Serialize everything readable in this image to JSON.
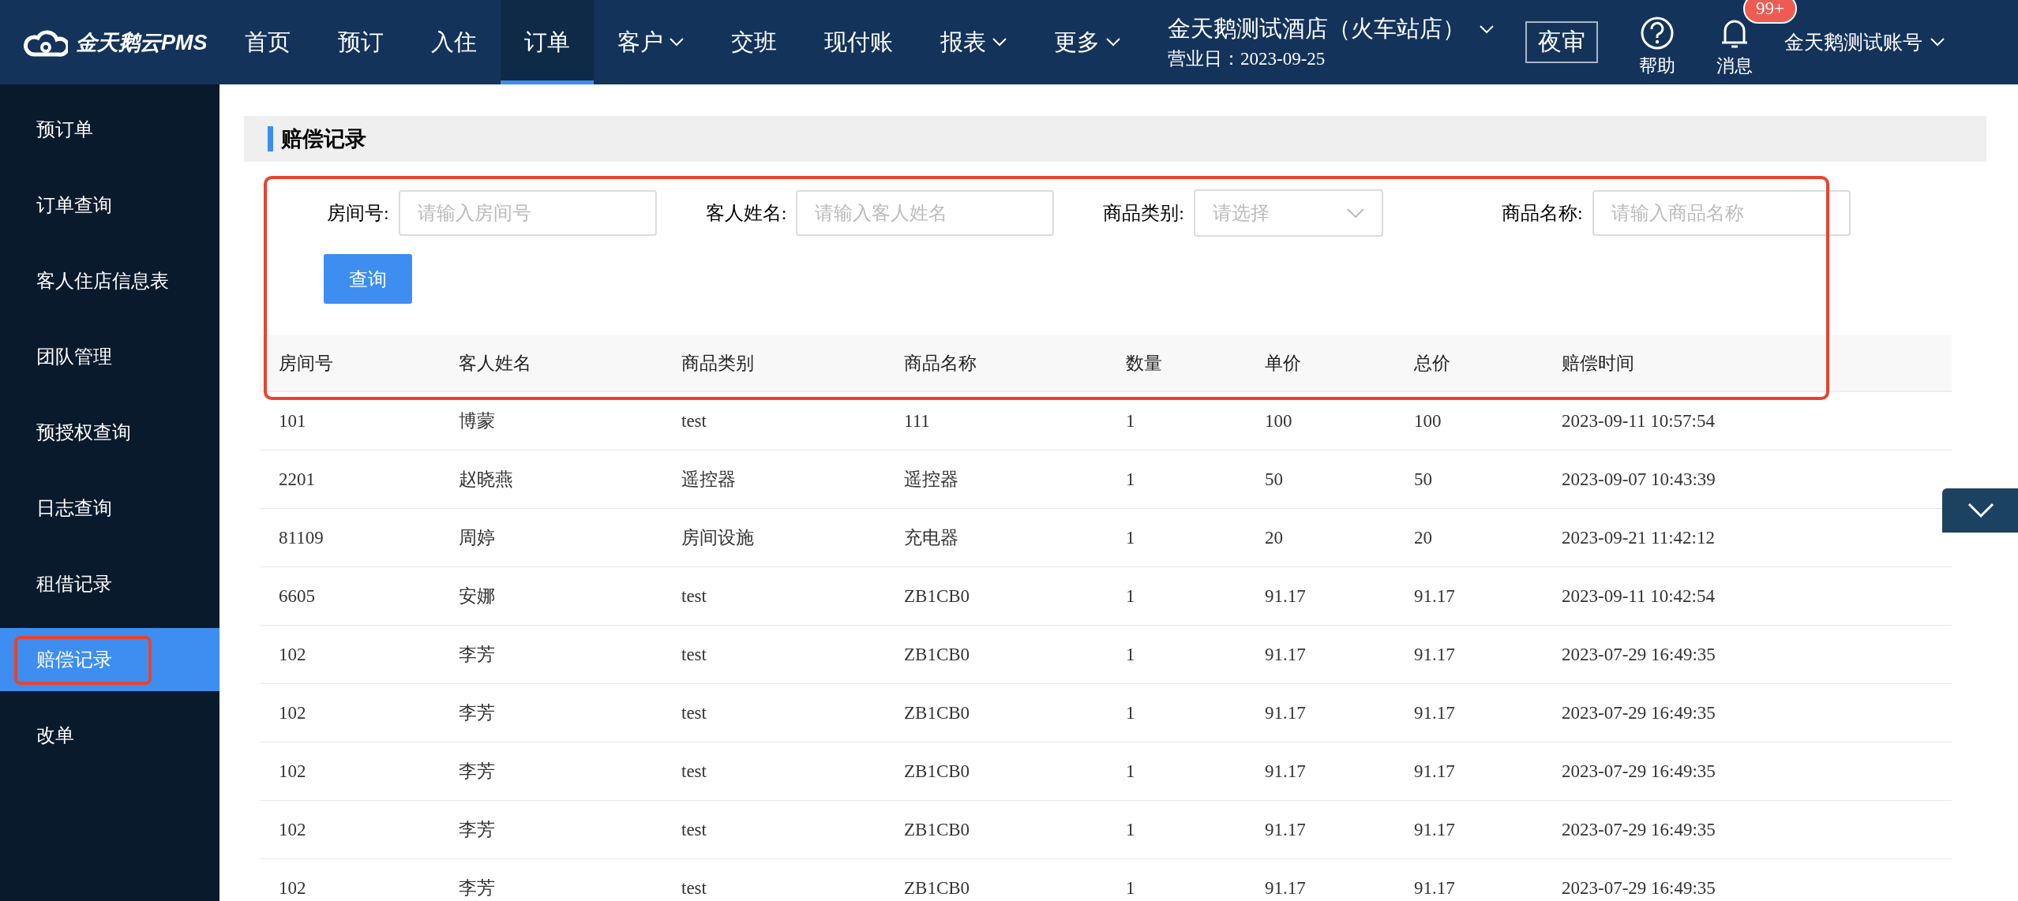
{
  "header": {
    "logo": "金天鹅云PMS",
    "nav": [
      {
        "label": "首页",
        "selected": false,
        "dropdown": false
      },
      {
        "label": "预订",
        "selected": false,
        "dropdown": false
      },
      {
        "label": "入住",
        "selected": false,
        "dropdown": false
      },
      {
        "label": "订单",
        "selected": true,
        "dropdown": false
      },
      {
        "label": "客户",
        "selected": false,
        "dropdown": true
      },
      {
        "label": "交班",
        "selected": false,
        "dropdown": false
      },
      {
        "label": "现付账",
        "selected": false,
        "dropdown": false
      },
      {
        "label": "报表",
        "selected": false,
        "dropdown": true
      },
      {
        "label": "更多",
        "selected": false,
        "dropdown": true
      }
    ],
    "hotel": "金天鹅测试酒店（火车站店）",
    "business_date": "营业日：2023-09-25",
    "night_audit": "夜审",
    "help": "帮助",
    "messages": "消息",
    "message_badge": "99+",
    "account": "金天鹅测试账号"
  },
  "sidebar": {
    "items": [
      {
        "label": "预订单",
        "selected": false,
        "highlighted": false
      },
      {
        "label": "订单查询",
        "selected": false,
        "highlighted": false
      },
      {
        "label": "客人住店信息表",
        "selected": false,
        "highlighted": false
      },
      {
        "label": "团队管理",
        "selected": false,
        "highlighted": false
      },
      {
        "label": "预授权查询",
        "selected": false,
        "highlighted": false
      },
      {
        "label": "日志查询",
        "selected": false,
        "highlighted": false
      },
      {
        "label": "租借记录",
        "selected": false,
        "highlighted": false
      },
      {
        "label": "赔偿记录",
        "selected": true,
        "highlighted": true
      },
      {
        "label": "改单",
        "selected": false,
        "highlighted": false
      }
    ]
  },
  "page_title": "赔偿记录",
  "filters": {
    "highlighted": true,
    "fields": [
      {
        "kind": "input",
        "label": "房间号:",
        "placeholder": "请输入房间号"
      },
      {
        "kind": "input",
        "label": "客人姓名:",
        "placeholder": "请输入客人姓名"
      },
      {
        "kind": "select",
        "label": "商品类别:",
        "placeholder": "请选择"
      },
      {
        "kind": "input",
        "label": "商品名称:",
        "placeholder": "请输入商品名称"
      }
    ],
    "search_button": "查询"
  },
  "table": {
    "columns": [
      "房间号",
      "客人姓名",
      "商品类别",
      "商品名称",
      "数量",
      "单价",
      "总价",
      "赔偿时间"
    ],
    "rows": [
      [
        "101",
        "博蒙",
        "test",
        "111",
        "1",
        "100",
        "100",
        "2023-09-11 10:57:54"
      ],
      [
        "2201",
        "赵晓燕",
        "遥控器",
        "遥控器",
        "1",
        "50",
        "50",
        "2023-09-07 10:43:39"
      ],
      [
        "81109",
        "周婷",
        "房间设施",
        "充电器",
        "1",
        "20",
        "20",
        "2023-09-21 11:42:12"
      ],
      [
        "6605",
        "安娜",
        "test",
        "ZB1CB0",
        "1",
        "91.17",
        "91.17",
        "2023-09-11 10:42:54"
      ],
      [
        "102",
        "李芳",
        "test",
        "ZB1CB0",
        "1",
        "91.17",
        "91.17",
        "2023-07-29 16:49:35"
      ],
      [
        "102",
        "李芳",
        "test",
        "ZB1CB0",
        "1",
        "91.17",
        "91.17",
        "2023-07-29 16:49:35"
      ],
      [
        "102",
        "李芳",
        "test",
        "ZB1CB0",
        "1",
        "91.17",
        "91.17",
        "2023-07-29 16:49:35"
      ],
      [
        "102",
        "李芳",
        "test",
        "ZB1CB0",
        "1",
        "91.17",
        "91.17",
        "2023-07-29 16:49:35"
      ],
      [
        "102",
        "李芳",
        "test",
        "ZB1CB0",
        "1",
        "91.17",
        "91.17",
        "2023-07-29 16:49:35"
      ]
    ]
  }
}
